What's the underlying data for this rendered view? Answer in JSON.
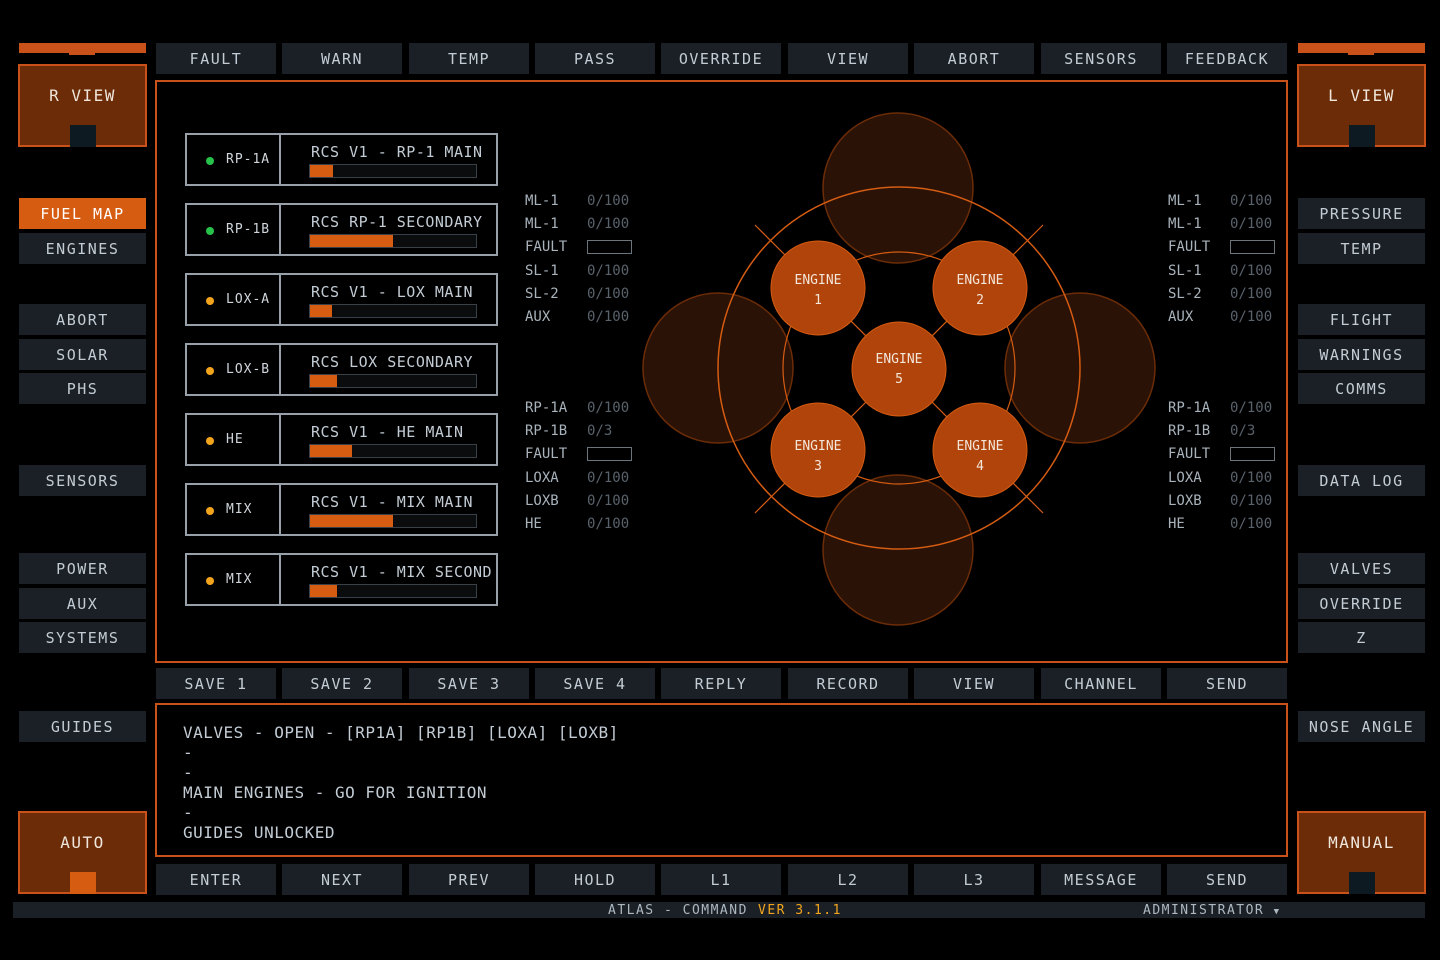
{
  "top_nav": [
    "FAULT",
    "WARN",
    "TEMP",
    "PASS",
    "OVERRIDE",
    "VIEW",
    "ABORT",
    "SENSORS",
    "FEEDBACK"
  ],
  "mid_nav": [
    "SAVE 1",
    "SAVE 2",
    "SAVE 3",
    "SAVE 4",
    "REPLY",
    "RECORD",
    "VIEW",
    "CHANNEL",
    "SEND"
  ],
  "bottom_nav": [
    "ENTER",
    "NEXT",
    "PREV",
    "HOLD",
    "L1",
    "L2",
    "L3",
    "MESSAGE",
    "SEND"
  ],
  "left_view": "R VIEW",
  "right_view": "L VIEW",
  "left_menu": {
    "fuel_map": "FUEL MAP",
    "engines": "ENGINES",
    "abort": "ABORT",
    "solar": "SOLAR",
    "phs": "PHS",
    "sensors": "SENSORS",
    "power": "POWER",
    "aux": "AUX",
    "systems": "SYSTEMS",
    "guides": "GUIDES"
  },
  "right_menu": {
    "pressure": "PRESSURE",
    "temp": "TEMP",
    "flight": "FLIGHT",
    "warnings": "WARNINGS",
    "comms": "COMMS",
    "data_log": "DATA LOG",
    "valves": "VALVES",
    "override": "OVERRIDE",
    "z": "Z",
    "nose_angle": "NOSE ANGLE"
  },
  "auto_label": "AUTO",
  "manual_label": "MANUAL",
  "fuel_lines": [
    {
      "tag": "RP-1A",
      "title": "RCS V1 - RP-1 MAIN",
      "level": 0.14,
      "status_color": "#27c24a"
    },
    {
      "tag": "RP-1B",
      "title": "RCS RP-1 SECONDARY",
      "level": 0.5,
      "status_color": "#27c24a"
    },
    {
      "tag": "LOX-A",
      "title": "RCS V1 - LOX MAIN",
      "level": 0.13,
      "status_color": "#f2a51c"
    },
    {
      "tag": "LOX-B",
      "title": "RCS LOX SECONDARY",
      "level": 0.16,
      "status_color": "#f2a51c"
    },
    {
      "tag": "HE",
      "title": "RCS V1 - HE MAIN",
      "level": 0.25,
      "status_color": "#f2a51c"
    },
    {
      "tag": "MIX",
      "title": "RCS V1 - MIX MAIN",
      "level": 0.5,
      "status_color": "#f2a51c"
    },
    {
      "tag": "MIX",
      "title": "RCS V1 - MIX SECOND",
      "level": 0.16,
      "status_color": "#f2a51c"
    }
  ],
  "readouts_upper": [
    {
      "k": "ML-1",
      "v": "0/100"
    },
    {
      "k": "ML-1",
      "v": "0/100"
    },
    {
      "k": "FAULT",
      "v": ""
    },
    {
      "k": "SL-1",
      "v": "0/100"
    },
    {
      "k": "SL-2",
      "v": "0/100"
    },
    {
      "k": "AUX",
      "v": "0/100"
    }
  ],
  "readouts_lower": [
    {
      "k": "RP-1A",
      "v": "0/100"
    },
    {
      "k": "RP-1B",
      "v": "0/3"
    },
    {
      "k": "FAULT",
      "v": ""
    },
    {
      "k": "LOXA",
      "v": "0/100"
    },
    {
      "k": "LOXB",
      "v": "0/100"
    },
    {
      "k": "HE",
      "v": "0/100"
    }
  ],
  "engines": [
    {
      "name": "ENGINE",
      "num": "1"
    },
    {
      "name": "ENGINE",
      "num": "2"
    },
    {
      "name": "ENGINE",
      "num": "5"
    },
    {
      "name": "ENGINE",
      "num": "3"
    },
    {
      "name": "ENGINE",
      "num": "4"
    }
  ],
  "log_lines": [
    "VALVES - OPEN - [RP1A] [RP1B] [LOXA] [LOXB]",
    "-",
    "-",
    "MAIN ENGINES - GO FOR IGNITION",
    "-",
    "GUIDES UNLOCKED"
  ],
  "status_bar": {
    "app": "ATLAS - COMMAND",
    "version": "VER 3.1.1",
    "user": "ADMINISTRATOR"
  },
  "colors": {
    "accent": "#d65c12",
    "accent_dark": "#6b2c07",
    "border": "#c9521a",
    "button_bg": "#1b2026",
    "version": "#f2a51c"
  }
}
